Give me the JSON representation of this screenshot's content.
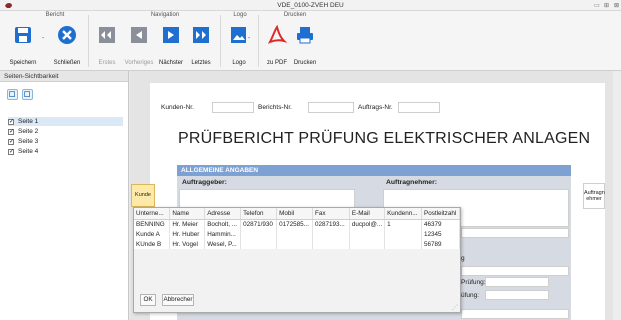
{
  "window": {
    "title": "VDE_0100-ZVEH DEU"
  },
  "ribbon": {
    "groups": [
      {
        "label": "Bericht"
      },
      {
        "label": "Navigation"
      },
      {
        "label": "Logo"
      },
      {
        "label": "Drucken"
      }
    ],
    "buttons": {
      "speichern": "Speichern",
      "schliessen": "Schließen",
      "erstes": "Erstes",
      "vorheriges": "Vorheriges",
      "naechster": "Nächster",
      "letztes": "Letztes",
      "logo": "Logo",
      "zu_pdf": "zu PDF",
      "drucken": "Drucken"
    },
    "colors": {
      "accent": "#1e6fd0",
      "disabled": "#8a8f99",
      "pdf": "#e02828"
    }
  },
  "sidebar": {
    "header": "Seiten-Sichtbarkeit",
    "pages": [
      {
        "label": "Seite 1",
        "checked": true,
        "selected": true
      },
      {
        "label": "Seite 2",
        "checked": true,
        "selected": false
      },
      {
        "label": "Seite 3",
        "checked": true,
        "selected": false
      },
      {
        "label": "Seite 4",
        "checked": true,
        "selected": false
      }
    ]
  },
  "report": {
    "kunden_nr_label": "Kunden-Nr.",
    "berichts_nr_label": "Berichts-Nr.",
    "auftrags_nr_label": "Auftrags-Nr.",
    "title": "PRÜFBERICHT PRÜFUNG ELEKTRISCHER ANLAGEN",
    "section": "ALLGEMEINE ANGABEN",
    "auftraggeber": "Auftraggeber:",
    "auftragnehmer": "Auftragnehmer:",
    "kunde_button": "Kunde",
    "auftragnehmer_button_1": "Auftragn",
    "auftragnehmer_button_2": "ehmer",
    "partial_g": "g",
    "partial_pruefung_1": "Prüfung:",
    "partial_pruefung_2": "üfung:"
  },
  "customer_popup": {
    "columns": [
      "Unterne...",
      "Name",
      "Adresse",
      "Telefon",
      "Mobil",
      "Fax",
      "E-Mail",
      "Kundenn...",
      "Postleitzahl"
    ],
    "rows": [
      [
        "BENNING",
        "Hr. Meier",
        "Bocholt, ...",
        "02871/930",
        "0172585...",
        "0287193...",
        "ducpol@...",
        "1",
        "46379"
      ],
      [
        "Kunde A",
        "Hr. Huber",
        "Hammin...",
        "",
        "",
        "",
        "",
        "",
        "12345"
      ],
      [
        "KUnde B",
        "Hr. Vogel",
        "Wesel, P...",
        "",
        "",
        "",
        "",
        "",
        "56789"
      ]
    ],
    "ok_label": "OK",
    "cancel_label": "Abbrecher"
  }
}
